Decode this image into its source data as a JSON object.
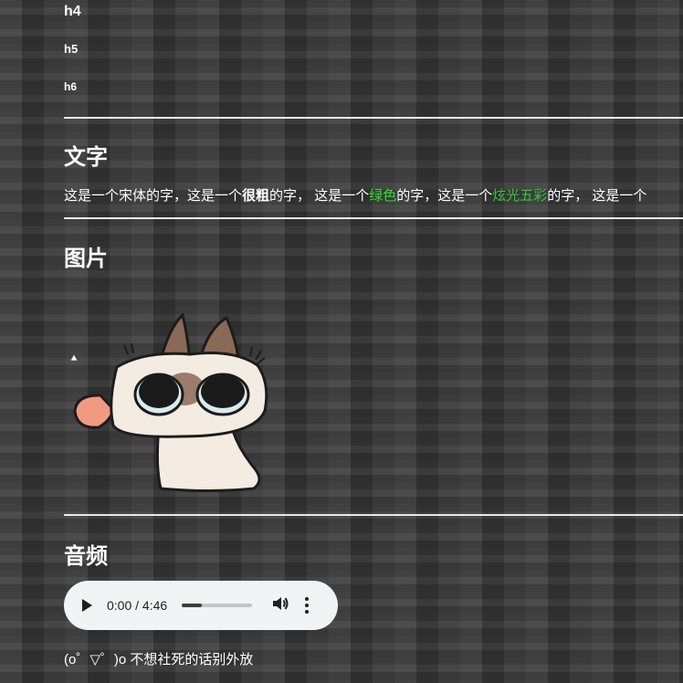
{
  "headings": {
    "h4": "h4",
    "h5": "h5",
    "h6": "h6",
    "text_section": "文字",
    "image_section": "图片",
    "audio_section": "音频"
  },
  "text_line": {
    "part1": "这是一个宋体的字，这是一个",
    "bold": "很粗",
    "part2": "的字，  这是一个",
    "green": "绿色",
    "part3": "的字，这是一个",
    "rainbow": "炫光五彩",
    "part4": "的字，  这是一个"
  },
  "audio": {
    "time": "0:00 / 4:46",
    "progress": 0.28,
    "caption": "(o゜▽゜)o 不想社死的话别外放"
  },
  "colors": {
    "green": "#2ee02e",
    "rainbow": "#35c835",
    "player_bg": "#f1f3f4"
  },
  "icons": [
    "play-icon",
    "volume-icon",
    "more-icon",
    "broken-image-icon"
  ]
}
